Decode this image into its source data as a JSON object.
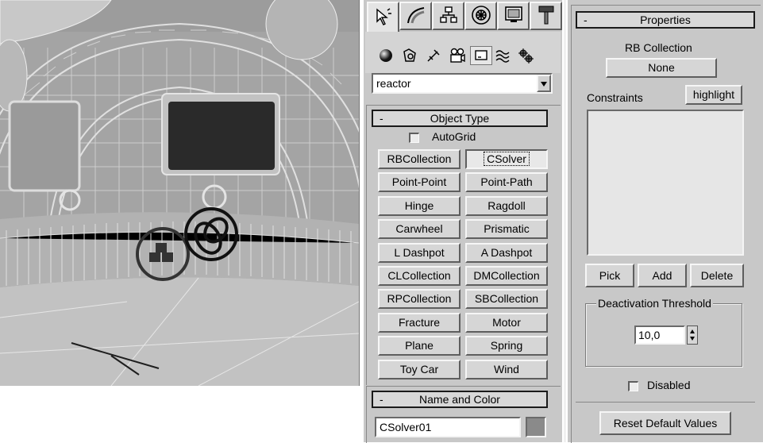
{
  "command_panel": {
    "tabs": [
      {
        "icon": "create-arrow-icon",
        "active": true
      },
      {
        "icon": "modify-arc-icon",
        "active": false
      },
      {
        "icon": "hierarchy-icon",
        "active": false
      },
      {
        "icon": "motion-icon",
        "active": false
      },
      {
        "icon": "display-icon",
        "active": false
      },
      {
        "icon": "utilities-hammer-icon",
        "active": false
      }
    ],
    "subcategory_icons": [
      "sphere-geometry-icon",
      "shapes-icon",
      "lights-icon",
      "cameras-icon",
      "helpers-icon",
      "spacewarps-icon",
      "systems-icon"
    ],
    "category_dropdown": {
      "value": "reactor"
    },
    "object_type": {
      "title": "Object Type",
      "autogrid_label": "AutoGrid",
      "autogrid_checked": false,
      "buttons": [
        [
          "RBCollection",
          "CSolver"
        ],
        [
          "Point-Point",
          "Point-Path"
        ],
        [
          "Hinge",
          "Ragdoll"
        ],
        [
          "Carwheel",
          "Prismatic"
        ],
        [
          "L Dashpot",
          "A Dashpot"
        ],
        [
          "CLCollection",
          "DMCollection"
        ],
        [
          "RPCollection",
          "SBCollection"
        ],
        [
          "Fracture",
          "Motor"
        ],
        [
          "Plane",
          "Spring"
        ],
        [
          "Toy Car",
          "Wind"
        ]
      ],
      "selected": "CSolver"
    },
    "name_and_color": {
      "title": "Name and Color",
      "name_value": "CSolver01",
      "color_swatch": "#8a8a8a"
    }
  },
  "properties": {
    "title": "Properties",
    "rb_collection_label": "RB Collection",
    "rb_collection_button": "None",
    "constraints_label": "Constraints",
    "highlight_button": "highlight",
    "pick_button": "Pick",
    "add_button": "Add",
    "delete_button": "Delete",
    "deactivation_group_label": "Deactivation Threshold",
    "deactivation_value": "10,0",
    "disabled_label": "Disabled",
    "disabled_checked": false,
    "reset_button": "Reset Default Values"
  },
  "colors": {
    "panel_bg": "#c8c8c8",
    "viewport_bg": "#9e9e9e"
  }
}
